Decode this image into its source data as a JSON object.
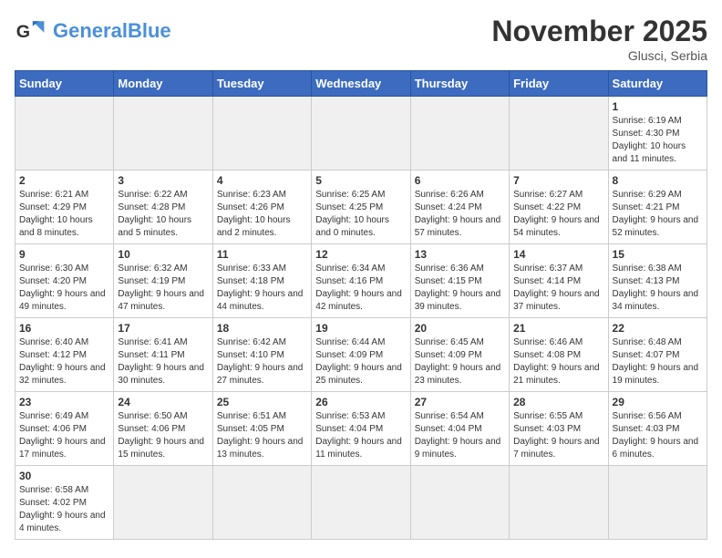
{
  "header": {
    "logo_general": "General",
    "logo_blue": "Blue",
    "month_title": "November 2025",
    "location": "Glusci, Serbia"
  },
  "days_of_week": [
    "Sunday",
    "Monday",
    "Tuesday",
    "Wednesday",
    "Thursday",
    "Friday",
    "Saturday"
  ],
  "weeks": [
    [
      {
        "day": "",
        "info": ""
      },
      {
        "day": "",
        "info": ""
      },
      {
        "day": "",
        "info": ""
      },
      {
        "day": "",
        "info": ""
      },
      {
        "day": "",
        "info": ""
      },
      {
        "day": "",
        "info": ""
      },
      {
        "day": "1",
        "info": "Sunrise: 6:19 AM\nSunset: 4:30 PM\nDaylight: 10 hours and 11 minutes."
      }
    ],
    [
      {
        "day": "2",
        "info": "Sunrise: 6:21 AM\nSunset: 4:29 PM\nDaylight: 10 hours and 8 minutes."
      },
      {
        "day": "3",
        "info": "Sunrise: 6:22 AM\nSunset: 4:28 PM\nDaylight: 10 hours and 5 minutes."
      },
      {
        "day": "4",
        "info": "Sunrise: 6:23 AM\nSunset: 4:26 PM\nDaylight: 10 hours and 2 minutes."
      },
      {
        "day": "5",
        "info": "Sunrise: 6:25 AM\nSunset: 4:25 PM\nDaylight: 10 hours and 0 minutes."
      },
      {
        "day": "6",
        "info": "Sunrise: 6:26 AM\nSunset: 4:24 PM\nDaylight: 9 hours and 57 minutes."
      },
      {
        "day": "7",
        "info": "Sunrise: 6:27 AM\nSunset: 4:22 PM\nDaylight: 9 hours and 54 minutes."
      },
      {
        "day": "8",
        "info": "Sunrise: 6:29 AM\nSunset: 4:21 PM\nDaylight: 9 hours and 52 minutes."
      }
    ],
    [
      {
        "day": "9",
        "info": "Sunrise: 6:30 AM\nSunset: 4:20 PM\nDaylight: 9 hours and 49 minutes."
      },
      {
        "day": "10",
        "info": "Sunrise: 6:32 AM\nSunset: 4:19 PM\nDaylight: 9 hours and 47 minutes."
      },
      {
        "day": "11",
        "info": "Sunrise: 6:33 AM\nSunset: 4:18 PM\nDaylight: 9 hours and 44 minutes."
      },
      {
        "day": "12",
        "info": "Sunrise: 6:34 AM\nSunset: 4:16 PM\nDaylight: 9 hours and 42 minutes."
      },
      {
        "day": "13",
        "info": "Sunrise: 6:36 AM\nSunset: 4:15 PM\nDaylight: 9 hours and 39 minutes."
      },
      {
        "day": "14",
        "info": "Sunrise: 6:37 AM\nSunset: 4:14 PM\nDaylight: 9 hours and 37 minutes."
      },
      {
        "day": "15",
        "info": "Sunrise: 6:38 AM\nSunset: 4:13 PM\nDaylight: 9 hours and 34 minutes."
      }
    ],
    [
      {
        "day": "16",
        "info": "Sunrise: 6:40 AM\nSunset: 4:12 PM\nDaylight: 9 hours and 32 minutes."
      },
      {
        "day": "17",
        "info": "Sunrise: 6:41 AM\nSunset: 4:11 PM\nDaylight: 9 hours and 30 minutes."
      },
      {
        "day": "18",
        "info": "Sunrise: 6:42 AM\nSunset: 4:10 PM\nDaylight: 9 hours and 27 minutes."
      },
      {
        "day": "19",
        "info": "Sunrise: 6:44 AM\nSunset: 4:09 PM\nDaylight: 9 hours and 25 minutes."
      },
      {
        "day": "20",
        "info": "Sunrise: 6:45 AM\nSunset: 4:09 PM\nDaylight: 9 hours and 23 minutes."
      },
      {
        "day": "21",
        "info": "Sunrise: 6:46 AM\nSunset: 4:08 PM\nDaylight: 9 hours and 21 minutes."
      },
      {
        "day": "22",
        "info": "Sunrise: 6:48 AM\nSunset: 4:07 PM\nDaylight: 9 hours and 19 minutes."
      }
    ],
    [
      {
        "day": "23",
        "info": "Sunrise: 6:49 AM\nSunset: 4:06 PM\nDaylight: 9 hours and 17 minutes."
      },
      {
        "day": "24",
        "info": "Sunrise: 6:50 AM\nSunset: 4:06 PM\nDaylight: 9 hours and 15 minutes."
      },
      {
        "day": "25",
        "info": "Sunrise: 6:51 AM\nSunset: 4:05 PM\nDaylight: 9 hours and 13 minutes."
      },
      {
        "day": "26",
        "info": "Sunrise: 6:53 AM\nSunset: 4:04 PM\nDaylight: 9 hours and 11 minutes."
      },
      {
        "day": "27",
        "info": "Sunrise: 6:54 AM\nSunset: 4:04 PM\nDaylight: 9 hours and 9 minutes."
      },
      {
        "day": "28",
        "info": "Sunrise: 6:55 AM\nSunset: 4:03 PM\nDaylight: 9 hours and 7 minutes."
      },
      {
        "day": "29",
        "info": "Sunrise: 6:56 AM\nSunset: 4:03 PM\nDaylight: 9 hours and 6 minutes."
      }
    ],
    [
      {
        "day": "30",
        "info": "Sunrise: 6:58 AM\nSunset: 4:02 PM\nDaylight: 9 hours and 4 minutes."
      },
      {
        "day": "",
        "info": ""
      },
      {
        "day": "",
        "info": ""
      },
      {
        "day": "",
        "info": ""
      },
      {
        "day": "",
        "info": ""
      },
      {
        "day": "",
        "info": ""
      },
      {
        "day": "",
        "info": ""
      }
    ]
  ]
}
